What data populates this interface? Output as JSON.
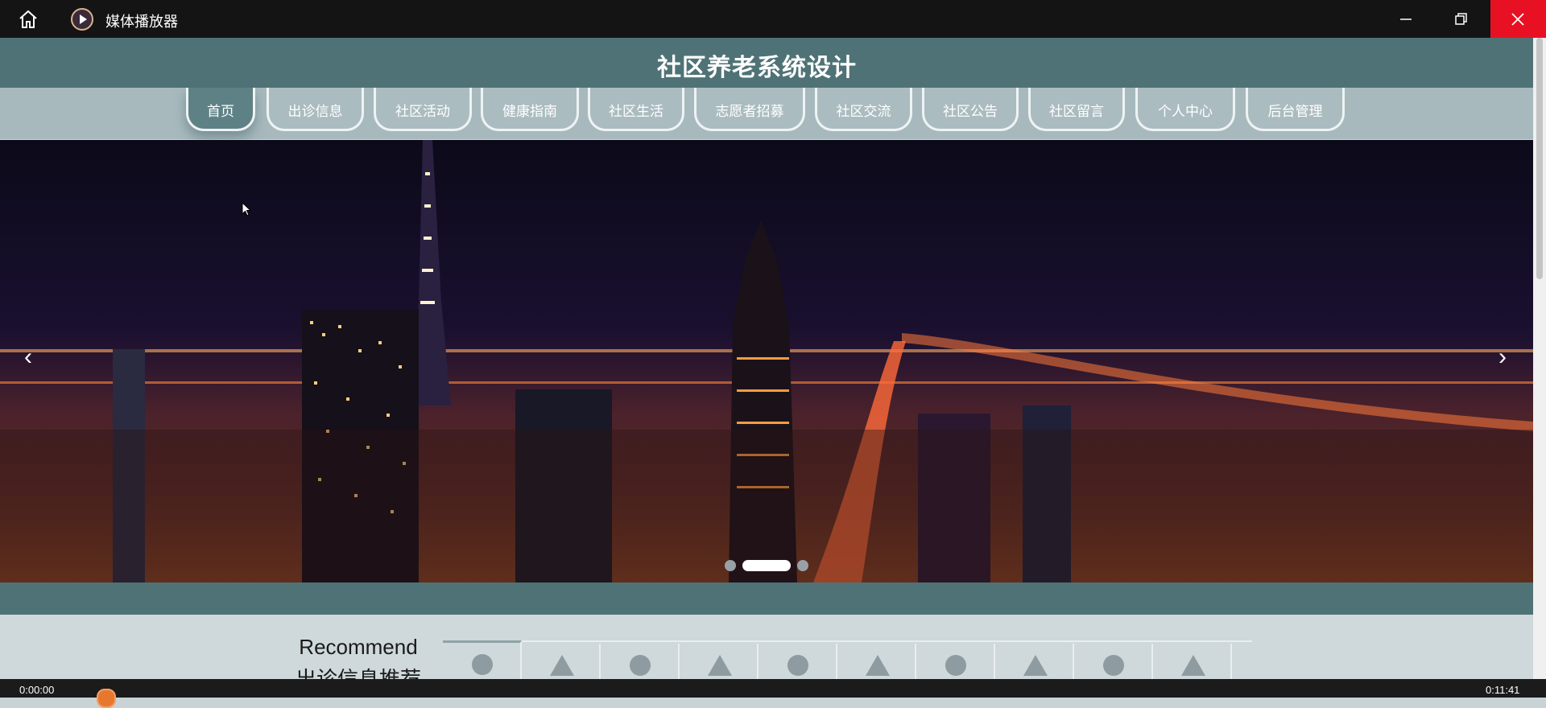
{
  "window": {
    "title": "媒体播放器",
    "icons": [
      "home-icon",
      "media-player-icon",
      "minimize-icon",
      "maximize-icon",
      "close-icon"
    ],
    "close_color": "#e81123"
  },
  "site": {
    "title": "社区养老系统设计",
    "nav": [
      {
        "label": "首页",
        "active": true
      },
      {
        "label": "出诊信息"
      },
      {
        "label": "社区活动"
      },
      {
        "label": "健康指南"
      },
      {
        "label": "社区生活"
      },
      {
        "label": "志愿者招募"
      },
      {
        "label": "社区交流"
      },
      {
        "label": "社区公告"
      },
      {
        "label": "社区留言"
      },
      {
        "label": "个人中心"
      },
      {
        "label": "后台管理"
      }
    ],
    "banner": {
      "prev": "‹",
      "next": "›",
      "slide_count": 3,
      "active_slide": 2
    },
    "recommend": {
      "title": "Recommend",
      "subtitle": "出诊信息推荐",
      "tab_shapes": [
        "circle",
        "triangle",
        "circle",
        "triangle",
        "circle",
        "triangle",
        "circle",
        "triangle",
        "circle",
        "triangle"
      ]
    },
    "colors": {
      "header": "#4f7276",
      "nav": "#a7b9bd",
      "page": "#cfd8da"
    }
  },
  "player": {
    "time_left": "0:00:00",
    "time_right": "0:11:41",
    "accent": "#e8772e"
  }
}
